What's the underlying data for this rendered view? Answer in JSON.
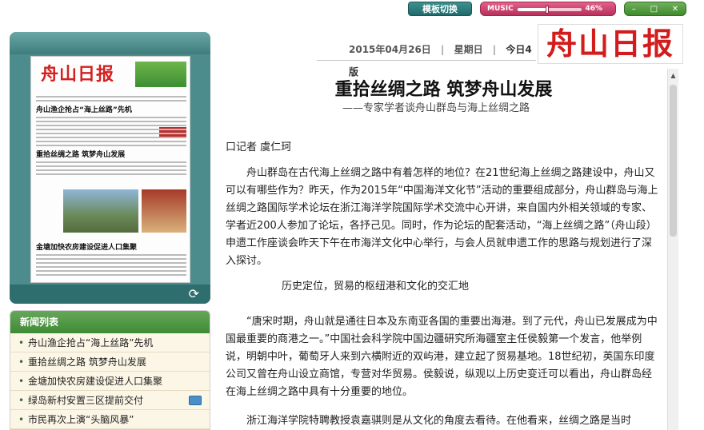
{
  "topbar": {
    "switch_label": "模板切换",
    "music_label": "MUSIC",
    "music_percent_text": "46%",
    "music_level": 0.46,
    "win_minimize": "–",
    "win_restore": "□",
    "win_close": "✕"
  },
  "header": {
    "date": "2015年04月26日",
    "weekday": "星期日",
    "edition": "今日4版",
    "logo_text": "舟山日报"
  },
  "thumbnail": {
    "logo": "舟山日报",
    "headline1": "舟山渔企抢占“海上丝路”先机",
    "headline2": "重拾丝绸之路 筑梦舟山发展",
    "headline3": "金塘加快农房建设促进人口集聚"
  },
  "article": {
    "title": "重拾丝绸之路  筑梦舟山发展",
    "subtitle": "——专家学者谈舟山群岛与海上丝绸之路",
    "byline": "口记者 虞仁珂",
    "p1": "舟山群岛在古代海上丝绸之路中有着怎样的地位？在21世纪海上丝绸之路建设中，舟山又可以有哪些作为？昨天，作为2015年“中国海洋文化节”活动的重要组成部分，舟山群岛与海上丝绸之路国际学术论坛在浙江海洋学院国际学术交流中心开讲，来自国内外相关领域的专家、学者近200人参加了论坛，各抒己见。同时，作为论坛的配套活动，“海上丝绸之路”（舟山段）申遗工作座谈会昨天下午在市海洋文化中心举行，与会人员就申遗工作的思路与规划进行了深入探讨。",
    "section1": "历史定位，贸易的枢纽港和文化的交汇地",
    "p2": "“唐宋时期，舟山就是通往日本及东南亚各国的重要出海港。到了元代，舟山已发展成为中国最重要的商港之一。”中国社会科学院中国边疆研究所海疆室主任侯毅第一个发言，他举例说，明朝中叶，葡萄牙人来到六横附近的双屿港，建立起了贸易基地。18世纪初，英国东印度公司又曾在舟山设立商馆，专营对华贸易。侯毅说，纵观以上历史变迁可以看出，舟山群岛经在海上丝绸之路中具有十分重要的地位。",
    "p3": "浙江海洋学院特聘教授袁嘉骐则是从文化的角度去看待。在他看来，丝绸之路是当时"
  },
  "news": {
    "title": "新闻列表",
    "items": [
      {
        "label": "舟山渔企抢占“海上丝路”先机",
        "video": false
      },
      {
        "label": "重拾丝绸之路 筑梦舟山发展",
        "video": false
      },
      {
        "label": "金塘加快农房建设促进人口集聚",
        "video": false
      },
      {
        "label": "绿岛新村安置三区提前交付",
        "video": true
      },
      {
        "label": "市民再次上演“头脑风暴”",
        "video": false
      }
    ]
  },
  "colors": {
    "accent_teal": "#4d8c8c",
    "news_green": "#3f8b35",
    "logo_red": "#d31c1c",
    "music_pink": "#c9416f"
  },
  "icons": {
    "refresh": "refresh-icon",
    "video": "video-icon",
    "bullet": "bullet-icon"
  }
}
